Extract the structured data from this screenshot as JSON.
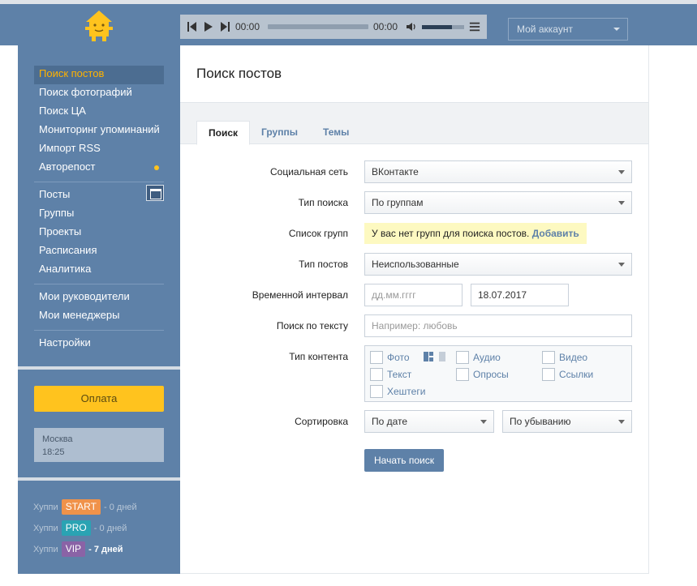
{
  "header": {
    "logo_icon": "house-mascot-icon",
    "player": {
      "prev_icon": "skip-back-icon",
      "play_icon": "play-icon",
      "next_icon": "skip-forward-icon",
      "time_current": "00:00",
      "time_total": "00:00",
      "volume_icon": "speaker-icon",
      "volume_level": 0.72,
      "playlist_icon": "playlist-icon"
    },
    "account_label": "Мой аккаунт"
  },
  "sidebar": {
    "groups": [
      [
        {
          "label": "Поиск постов",
          "active": true
        },
        {
          "label": "Поиск фотографий"
        },
        {
          "label": "Поиск ЦА"
        },
        {
          "label": "Мониторинг упоминаний"
        },
        {
          "label": "Импорт RSS"
        },
        {
          "label": "Авторепост",
          "dot": true
        }
      ],
      [
        {
          "label": "Посты",
          "icon": "window-icon"
        },
        {
          "label": "Группы"
        },
        {
          "label": "Проекты"
        },
        {
          "label": "Расписания"
        },
        {
          "label": "Аналитика"
        }
      ],
      [
        {
          "label": "Мои руководители"
        },
        {
          "label": "Мои менеджеры"
        }
      ],
      [
        {
          "label": "Настройки"
        }
      ]
    ],
    "pay_label": "Оплата",
    "clock": {
      "city": "Москва",
      "time": "18:25"
    },
    "plans": [
      {
        "prefix": "Хуппи",
        "badge": "START",
        "color": "#f0924a",
        "suffix": "- 0 дней",
        "bold": false
      },
      {
        "prefix": "Хуппи",
        "badge": "PRO",
        "color": "#2aa3b3",
        "suffix": "- 0 дней",
        "bold": false
      },
      {
        "prefix": "Хуппи",
        "badge": "VIP",
        "color": "#8a63a6",
        "suffix": "- 7 дней",
        "bold": true
      }
    ]
  },
  "main": {
    "title": "Поиск постов",
    "tabs": [
      "Поиск",
      "Группы",
      "Темы"
    ],
    "form": {
      "network_label": "Социальная сеть",
      "network_value": "ВКонтакте",
      "search_type_label": "Тип поиска",
      "search_type_value": "По группам",
      "group_list_label": "Список групп",
      "group_list_notice": "У вас нет групп для поиска постов.",
      "group_list_link": "Добавить",
      "post_type_label": "Тип постов",
      "post_type_value": "Неиспользованные",
      "interval_label": "Временной интервал",
      "date_from_placeholder": "дд.мм.гггг",
      "date_to_value": "18.07.2017",
      "text_search_label": "Поиск по тексту",
      "text_search_placeholder": "Например: любовь",
      "content_type_label": "Тип контента",
      "content_types": [
        "Фото",
        "Аудио",
        "Видео",
        "Текст",
        "Опросы",
        "Ссылки",
        "Хештеги"
      ],
      "sort_label": "Сортировка",
      "sort_by_value": "По дате",
      "sort_order_value": "По убыванию",
      "submit_label": "Начать поиск"
    }
  },
  "colors": {
    "topbar": "#5e81a8",
    "accent": "#ffc31e",
    "link": "#5e81a8"
  }
}
